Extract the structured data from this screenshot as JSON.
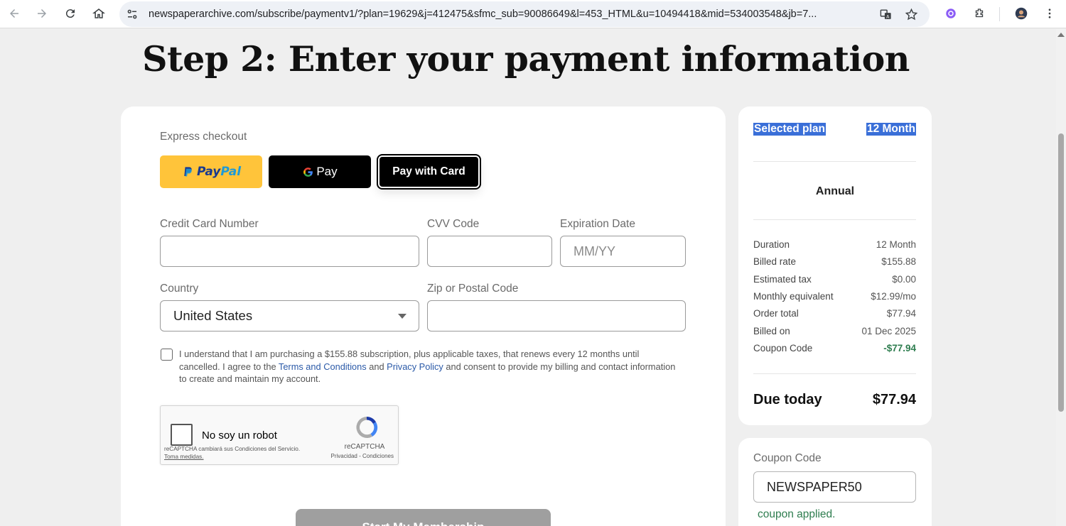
{
  "browser": {
    "url": "newspaperarchive.com/subscribe/paymentv1/?plan=19629&j=412475&sfmc_sub=90086649&l=453_HTML&u=10494418&mid=534003548&jb=7..."
  },
  "page": {
    "title": "Step 2: Enter your payment information"
  },
  "payment": {
    "express_label": "Express checkout",
    "paypal_part1": "Pay",
    "paypal_part2": "Pal",
    "gpay_label": "Pay",
    "card_label": "Pay with Card",
    "card_number_label": "Credit Card Number",
    "cvv_label": "CVV Code",
    "expiration_label": "Expiration Date",
    "expiration_placeholder": "MM/YY",
    "country_label": "Country",
    "country_value": "United States",
    "zip_label": "Zip or Postal Code",
    "consent_part1": "I understand that I am purchasing a $155.88 subscription, plus applicable taxes, that renews every 12 months until cancelled. I agree to the ",
    "terms_link": "Terms and Conditions",
    "consent_and": " and ",
    "privacy_link": "Privacy Policy",
    "consent_part2": " and consent to provide my billing and contact information to create and maintain my account.",
    "submit_label": "Start My Membership"
  },
  "captcha": {
    "label": "No soy un robot",
    "brand": "reCAPTCHA",
    "links": "Privacidad - Condiciones",
    "note": "reCAPTCHA cambiará sus Condiciones del Servicio. ",
    "note_link": "Toma medidas."
  },
  "summary": {
    "selected_plan_label": "Selected plan",
    "selected_plan_value": "12 Month",
    "plan_name": "Annual",
    "rows": [
      {
        "label": "Duration",
        "value": "12 Month"
      },
      {
        "label": "Billed rate",
        "value": "$155.88"
      },
      {
        "label": "Estimated tax",
        "value": "$0.00"
      },
      {
        "label": "Monthly equivalent",
        "value": "$12.99/mo"
      },
      {
        "label": "Order total",
        "value": "$77.94"
      },
      {
        "label": "Billed on",
        "value": "01 Dec 2025"
      },
      {
        "label": "Coupon Code",
        "value": "-$77.94"
      }
    ],
    "due_label": "Due today",
    "due_value": "$77.94"
  },
  "coupon": {
    "label": "Coupon Code",
    "value": "NEWSPAPER50",
    "message": "coupon applied."
  },
  "colors": {
    "paypal_yellow": "#ffc43a",
    "accent_green": "#2e7d4f",
    "selection_blue": "#3a6fd8"
  }
}
